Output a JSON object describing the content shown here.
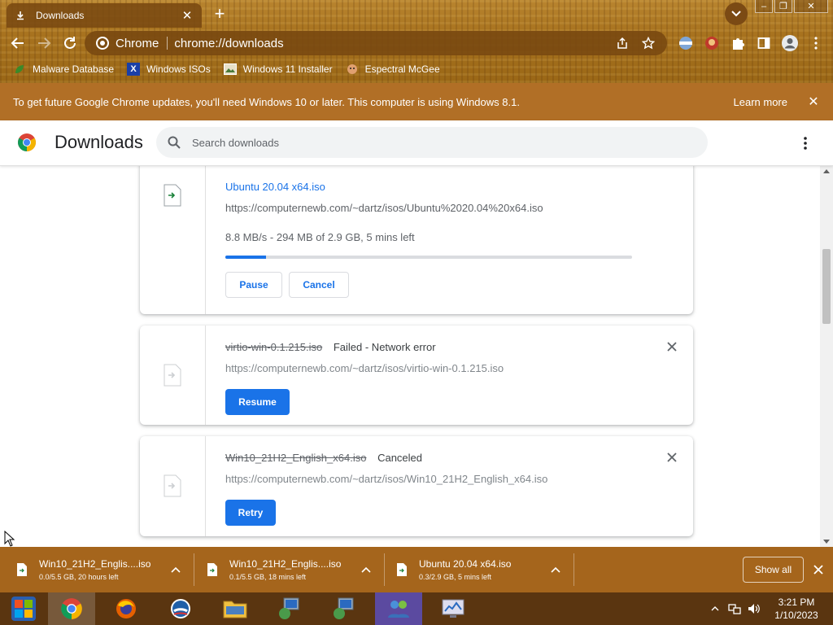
{
  "tab": {
    "title": "Downloads"
  },
  "omnibox": {
    "chip": "Chrome",
    "url": "chrome://downloads"
  },
  "bookmarks": [
    {
      "label": "Malware Database"
    },
    {
      "label": "Windows ISOs"
    },
    {
      "label": "Windows 11 Installer"
    },
    {
      "label": "Espectral McGee"
    }
  ],
  "infobar": {
    "message": "To get future Google Chrome updates, you'll need Windows 10 or later. This computer is using Windows 8.1.",
    "link": "Learn more"
  },
  "header": {
    "title": "Downloads",
    "search_placeholder": "Search downloads"
  },
  "downloads": [
    {
      "name": "Ubuntu 20.04 x64.iso",
      "url": "https://computernewb.com/~dartz/isos/Ubuntu%2020.04%20x64.iso",
      "description": "8.8 MB/s - 294 MB of 2.9 GB, 5 mins left",
      "progress": 0.1,
      "buttons": [
        "Pause",
        "Cancel"
      ]
    },
    {
      "name": "virtio-win-0.1.215.iso",
      "status": "Failed - Network error",
      "url": "https://computernewb.com/~dartz/isos/virtio-win-0.1.215.iso",
      "button": "Resume"
    },
    {
      "name": "Win10_21H2_English_x64.iso",
      "status": "Canceled",
      "url": "https://computernewb.com/~dartz/isos/Win10_21H2_English_x64.iso",
      "button": "Retry"
    }
  ],
  "shelf": {
    "items": [
      {
        "name": "Win10_21H2_Englis....iso",
        "sub": "0.0/5.5 GB, 20 hours left"
      },
      {
        "name": "Win10_21H2_Englis....iso",
        "sub": "0.1/5.5 GB, 18 mins left"
      },
      {
        "name": "Ubuntu 20.04 x64.iso",
        "sub": "0.3/2.9 GB, 5 mins left"
      }
    ],
    "show_all": "Show all"
  },
  "taskbar": {
    "time": "3:21 PM",
    "date": "1/10/2023"
  },
  "colors": {
    "accent": "#1a73e8",
    "theme_dark": "#a5651c",
    "infobar": "#b16f26"
  }
}
